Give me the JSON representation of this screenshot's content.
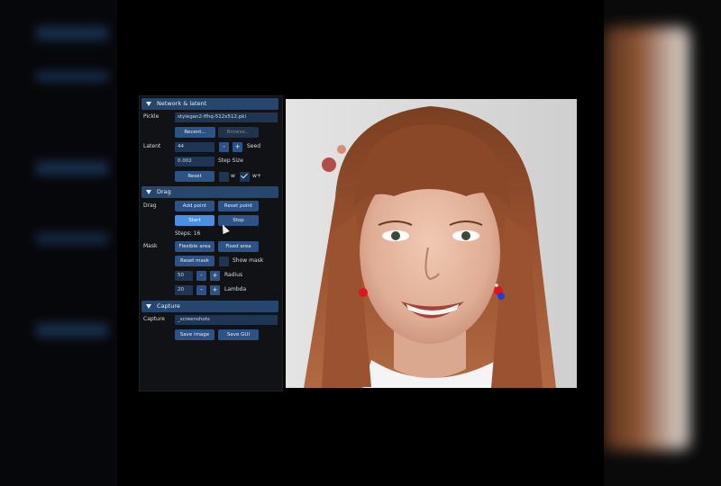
{
  "panel": {
    "network_section": "Network & latent",
    "pickle_label": "Pickle",
    "pickle_value": "stylegan2-ffhq-512x512.pkl",
    "recent_button": "Recent...",
    "browse_button": "Browse...",
    "latent_label": "Latent",
    "seed_value": "44",
    "seed_minus": "-",
    "seed_plus": "+",
    "seed_label": "Seed",
    "step_value": "0.002",
    "step_label": "Step Size",
    "reset_button": "Reset",
    "w_label": "w",
    "wplus_label": "w+",
    "drag_section": "Drag",
    "drag_label": "Drag",
    "add_point_button": "Add point",
    "reset_point_button": "Reset point",
    "start_button": "Start",
    "stop_button": "Stop",
    "steps_text": "Steps: 16",
    "mask_label": "Mask",
    "flexible_area_button": "Flexible area",
    "fixed_area_button": "Fixed area",
    "reset_mask_button": "Reset mask",
    "show_mask_label": "Show mask",
    "radius_value": "50",
    "radius_label": "Radius",
    "lambda_value": "20",
    "lambda_label": "Lambda",
    "capture_section": "Capture",
    "capture_label": "Capture",
    "capture_path": "_screenshots",
    "save_image_button": "Save image",
    "save_gui_button": "Save GUI"
  },
  "colors": {
    "section_header": "#26466e",
    "button": "#2d5285",
    "button_active": "#4a8fe3",
    "field": "#1f3554",
    "handle_point": "#e0141c",
    "target_point": "#1c3fd9"
  }
}
